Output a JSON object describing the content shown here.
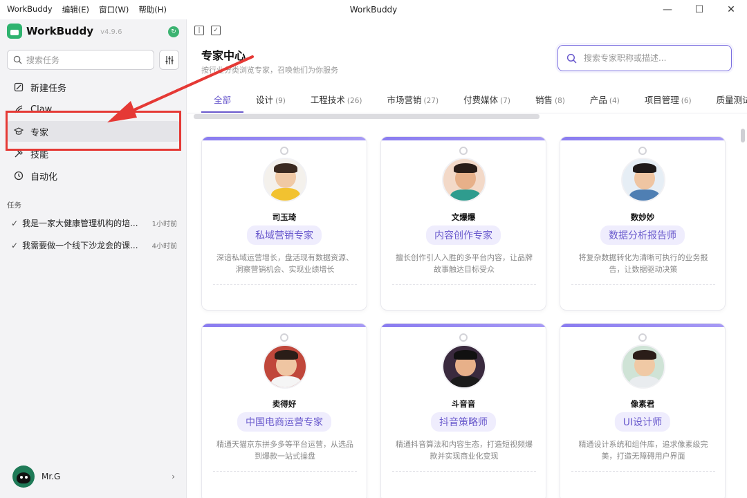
{
  "titlebar": {
    "menu": [
      "WorkBuddy",
      "编辑(E)",
      "窗口(W)",
      "帮助(H)"
    ],
    "title": "WorkBuddy",
    "minimize": "—",
    "maximize": "☐",
    "close": "✕"
  },
  "sidebar": {
    "brand": "WorkBuddy",
    "version": "v4.9.6",
    "badge": "↻",
    "search_placeholder": "搜索任务",
    "nav": [
      {
        "label": "新建任务",
        "icon": "new-task-icon"
      },
      {
        "label": "Claw",
        "icon": "claw-icon"
      },
      {
        "label": "专家",
        "icon": "graduation-cap-icon"
      },
      {
        "label": "技能",
        "icon": "skill-icon"
      },
      {
        "label": "自动化",
        "icon": "clock-icon"
      }
    ],
    "section_label": "任务",
    "tasks": [
      {
        "title": "我是一家大健康管理机构的培...",
        "time": "1小时前"
      },
      {
        "title": "我需要做一个线下沙龙会的课...",
        "time": "4小时前"
      }
    ],
    "user": {
      "name": "Mr.G"
    }
  },
  "main": {
    "title": "专家中心",
    "subtitle": "按行业分类浏览专家，召唤他们为你服务",
    "search_placeholder": "搜索专家职称或描述...",
    "tabs": [
      {
        "label": "全部",
        "count": ""
      },
      {
        "label": "设计",
        "count": "(9)"
      },
      {
        "label": "工程技术",
        "count": "(26)"
      },
      {
        "label": "市场营销",
        "count": "(27)"
      },
      {
        "label": "付费媒体",
        "count": "(7)"
      },
      {
        "label": "销售",
        "count": "(8)"
      },
      {
        "label": "产品",
        "count": "(4)"
      },
      {
        "label": "项目管理",
        "count": "(6)"
      },
      {
        "label": "质量测试",
        "count": ""
      }
    ],
    "cards": [
      {
        "name": "司玉琦",
        "role": "私域营销专家",
        "desc": "深谙私域运营增长，盘活现有数据资源、洞察营销机会、实现业绩增长",
        "color": "#f4f1ec"
      },
      {
        "name": "文爆爆",
        "role": "内容创作专家",
        "desc": "擅长创作引人入胜的多平台内容，让品牌故事触达目标受众",
        "color": "#f3d9c8"
      },
      {
        "name": "数妙妙",
        "role": "数据分析报告师",
        "desc": "将复杂数据转化为清晰可执行的业务报告，让数据驱动决策",
        "color": "#e6eef5"
      },
      {
        "name": "卖得好",
        "role": "中国电商运营专家",
        "desc": "精通天猫京东拼多多等平台运营，从选品到爆款一站式操盘",
        "color": "#c0473b"
      },
      {
        "name": "斗音音",
        "role": "抖音策略师",
        "desc": "精通抖音算法和内容生态，打造短视频爆款并实现商业化变现",
        "color": "#3a2a3e"
      },
      {
        "name": "像素君",
        "role": "UI设计师",
        "desc": "精通设计系统和组件库，追求像素级完美，打造无障碍用户界面",
        "color": "#cfe3d6"
      }
    ]
  }
}
